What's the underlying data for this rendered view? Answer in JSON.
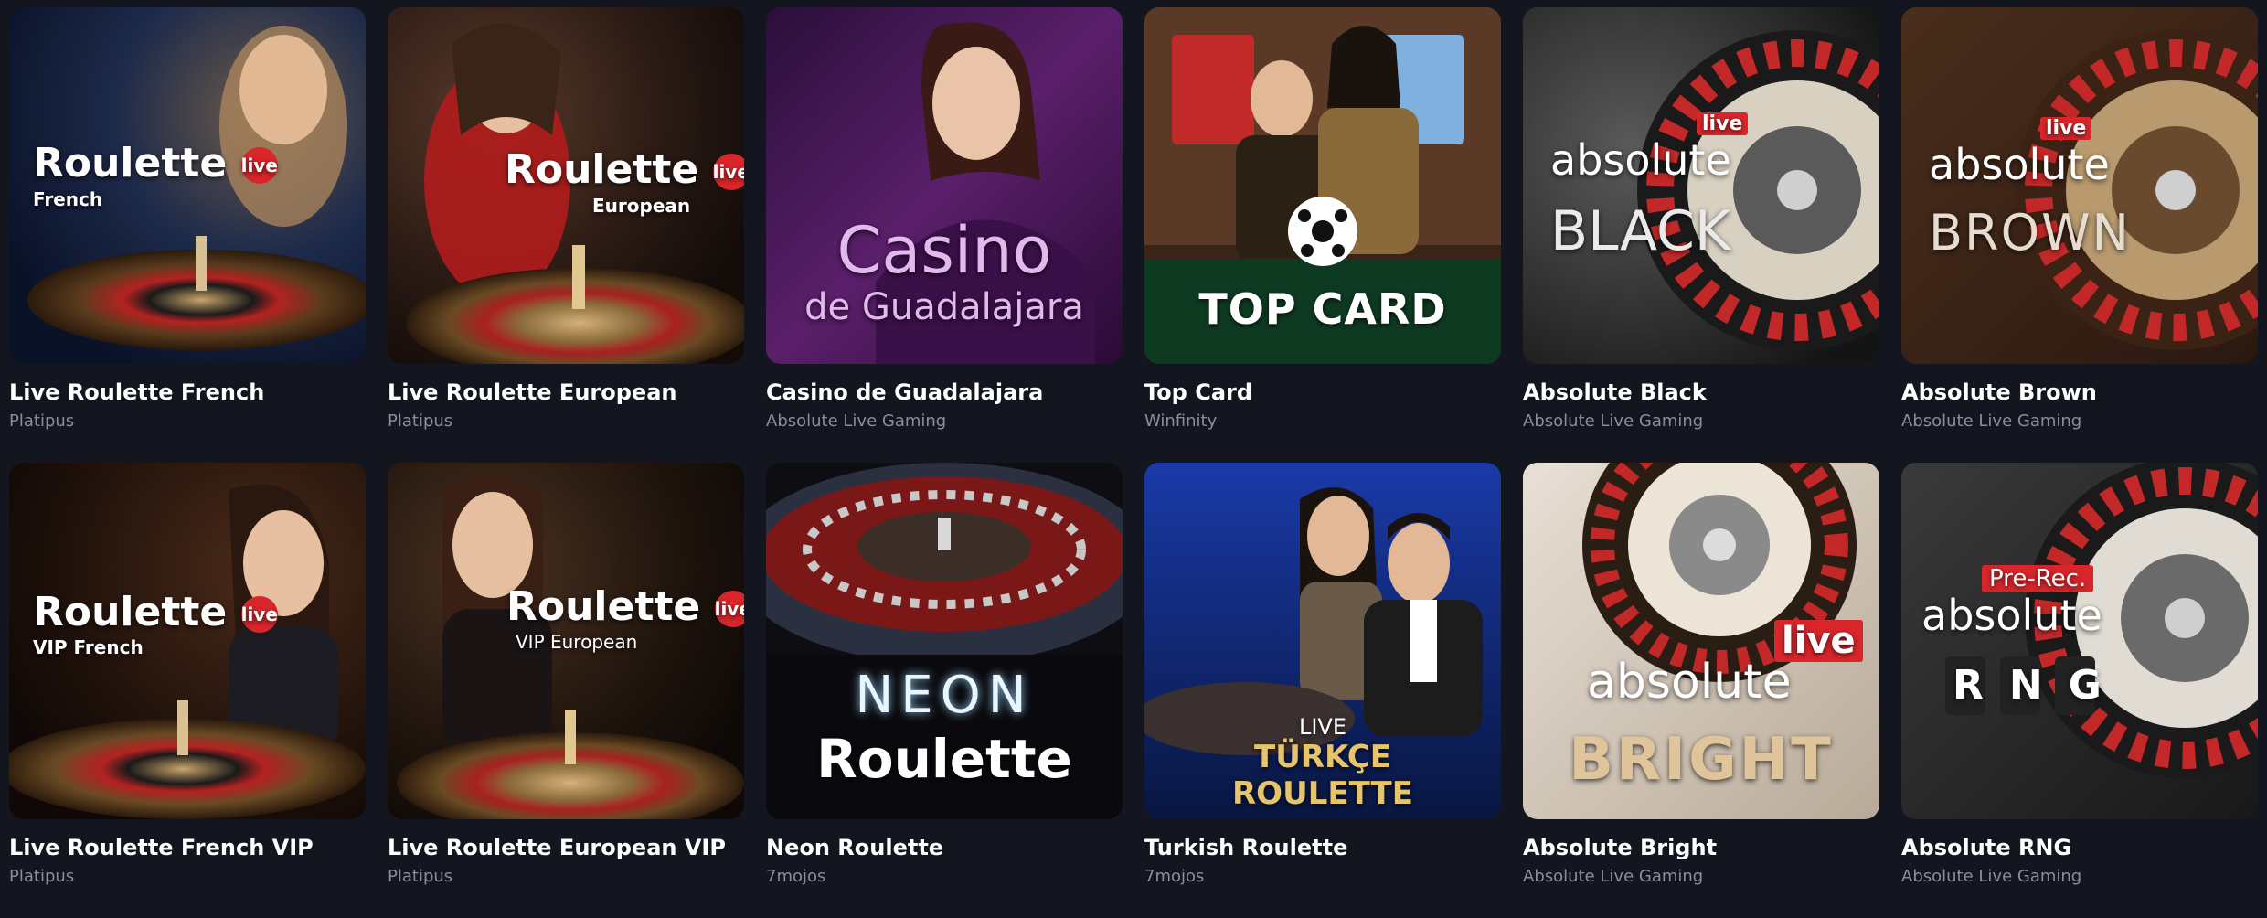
{
  "games": [
    {
      "title": "Live Roulette French",
      "provider": "Platipus",
      "art": {
        "main": "Roulette",
        "badge": "live",
        "sub": "French"
      }
    },
    {
      "title": "Live Roulette European",
      "provider": "Platipus",
      "art": {
        "main": "Roulette",
        "badge": "live",
        "sub": "European"
      }
    },
    {
      "title": "Casino de Guadalajara",
      "provider": "Absolute Live Gaming",
      "art": {
        "main": "Casino",
        "sub": "de Guadalajara"
      }
    },
    {
      "title": "Top Card",
      "provider": "Winfinity",
      "art": {
        "main": "TOP CARD"
      }
    },
    {
      "title": "Absolute Black",
      "provider": "Absolute Live Gaming",
      "art": {
        "badge": "live",
        "brand": "absolute",
        "main": "BLACK"
      }
    },
    {
      "title": "Absolute Brown",
      "provider": "Absolute Live Gaming",
      "art": {
        "badge": "live",
        "brand": "absolute",
        "main": "BROWN"
      }
    },
    {
      "title": "Live Roulette French VIP",
      "provider": "Platipus",
      "art": {
        "main": "Roulette",
        "badge": "live",
        "sub": "VIP French"
      }
    },
    {
      "title": "Live Roulette European VIP",
      "provider": "Platipus",
      "art": {
        "main": "Roulette",
        "badge": "live",
        "sub": "VIP European"
      }
    },
    {
      "title": "Neon Roulette",
      "provider": "7mojos",
      "art": {
        "top": "NEON",
        "main": "Roulette"
      }
    },
    {
      "title": "Turkish Roulette",
      "provider": "7mojos",
      "art": {
        "top": "LIVE",
        "mid": "TÜRKÇE",
        "main": "ROULETTE"
      }
    },
    {
      "title": "Absolute Bright",
      "provider": "Absolute Live Gaming",
      "art": {
        "badge": "live",
        "brand": "absolute",
        "main": "BRIGHT"
      }
    },
    {
      "title": "Absolute RNG",
      "provider": "Absolute Live Gaming",
      "art": {
        "badge": "Pre-Rec.",
        "brand": "absolute",
        "main": "RNG"
      }
    }
  ],
  "colors": {
    "background": "#14161f",
    "title": "#ffffff",
    "provider": "#8a8e99",
    "live_badge": "#d9262b"
  }
}
